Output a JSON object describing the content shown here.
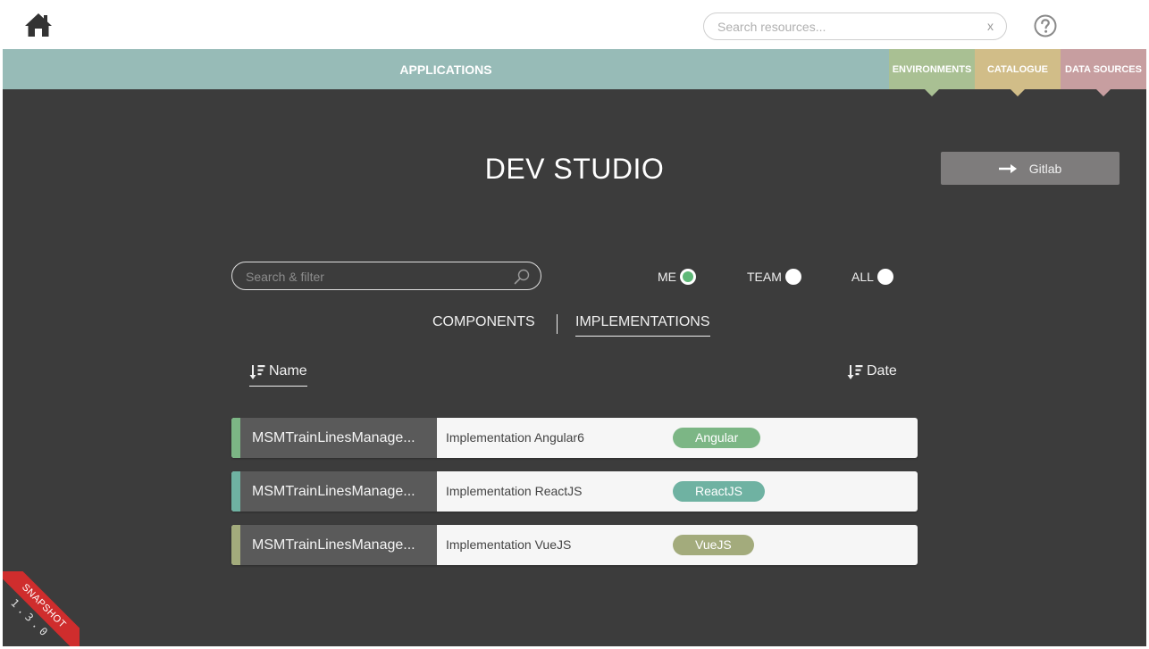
{
  "topbar": {
    "home_icon": "home-icon",
    "search_placeholder": "Search resources...",
    "search_value": "",
    "search_clear": "x",
    "help_icon": "question-circle-icon"
  },
  "nav": {
    "applications": "APPLICATIONS",
    "environments": "ENVIRONMENTS",
    "catalogue": "CATALOGUE",
    "data_sources": "DATA SOURCES",
    "colors": {
      "applications": "#97bbb7",
      "environments": "#a9c093",
      "catalogue": "#d1bd88",
      "data_sources": "#c79ea0"
    }
  },
  "main": {
    "title": "DEV STUDIO",
    "gitlab_label": "Gitlab",
    "filter_placeholder": "Search & filter",
    "filter_value": "",
    "scope": {
      "me": "ME",
      "team": "TEAM",
      "all": "ALL",
      "selected": "ME"
    },
    "tabs": {
      "components": "COMPONENTS",
      "implementations": "IMPLEMENTATIONS",
      "active": "IMPLEMENTATIONS"
    },
    "sort": {
      "name": "Name",
      "date": "Date",
      "active": "Name"
    },
    "rows": [
      {
        "name": "MSMTrainLinesManage...",
        "description": "Implementation Angular6",
        "tag": "Angular",
        "color": "#7cb685"
      },
      {
        "name": "MSMTrainLinesManage...",
        "description": "Implementation ReactJS",
        "tag": "ReactJS",
        "color": "#6fb2a2"
      },
      {
        "name": "MSMTrainLinesManage...",
        "description": "Implementation VueJS",
        "tag": "VueJS",
        "color": "#a3ab7c"
      }
    ]
  },
  "ribbon": {
    "label": "SNAPSHOT",
    "version": "1.3.0"
  }
}
